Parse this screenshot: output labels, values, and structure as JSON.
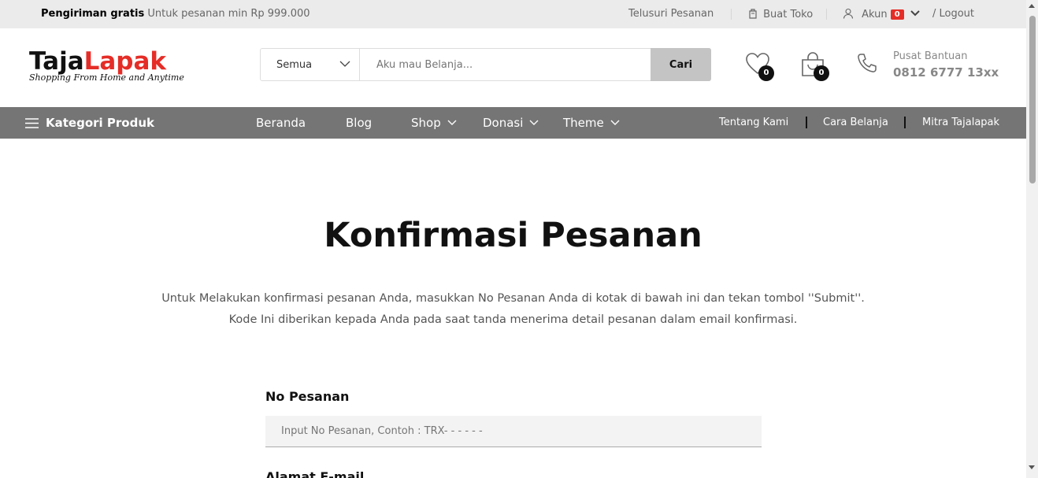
{
  "topbar": {
    "shipping_bold": "Pengiriman gratis",
    "shipping_text": "Untuk pesanan min Rp 999.000",
    "track_orders": "Telusuri Pesanan",
    "create_store": "Buat Toko",
    "account": "Akun",
    "account_badge": "0",
    "logout": "/ Logout"
  },
  "header": {
    "logo_part1": "Taja",
    "logo_part2": "Lapak",
    "logo_tagline": "Shopping From Home and Anytime",
    "search": {
      "category": "Semua",
      "placeholder": "Aku mau Belanja...",
      "button": "Cari"
    },
    "wishlist_count": "0",
    "cart_count": "0",
    "help_label": "Pusat Bantuan",
    "help_phone": "0812 6777 13xx"
  },
  "nav": {
    "categories": "Kategori Produk",
    "menu": {
      "home": "Beranda",
      "blog": "Blog",
      "shop": "Shop",
      "donation": "Donasi",
      "theme": "Theme"
    },
    "right_links": {
      "about": "Tentang Kami",
      "how_to_shop": "Cara Belanja",
      "partner": "Mitra Tajalapak"
    }
  },
  "main": {
    "title": "Konfirmasi Pesanan",
    "description": "Untuk Melakukan konfirmasi pesanan Anda, masukkan No Pesanan Anda di kotak di bawah ini dan tekan tombol ''Submit''. Kode Ini diberikan kepada Anda pada saat tanda menerima detail pesanan dalam email konfirmasi.",
    "order_label": "No Pesanan",
    "order_placeholder": "Input No Pesanan, Contoh : TRX- - - - - -",
    "email_label": "Alamat E-mail"
  },
  "colors": {
    "accent_red": "#e52d27",
    "nav_bg": "#757575",
    "topbar_bg": "#ebebeb",
    "search_button_bg": "#c4c4c4"
  }
}
